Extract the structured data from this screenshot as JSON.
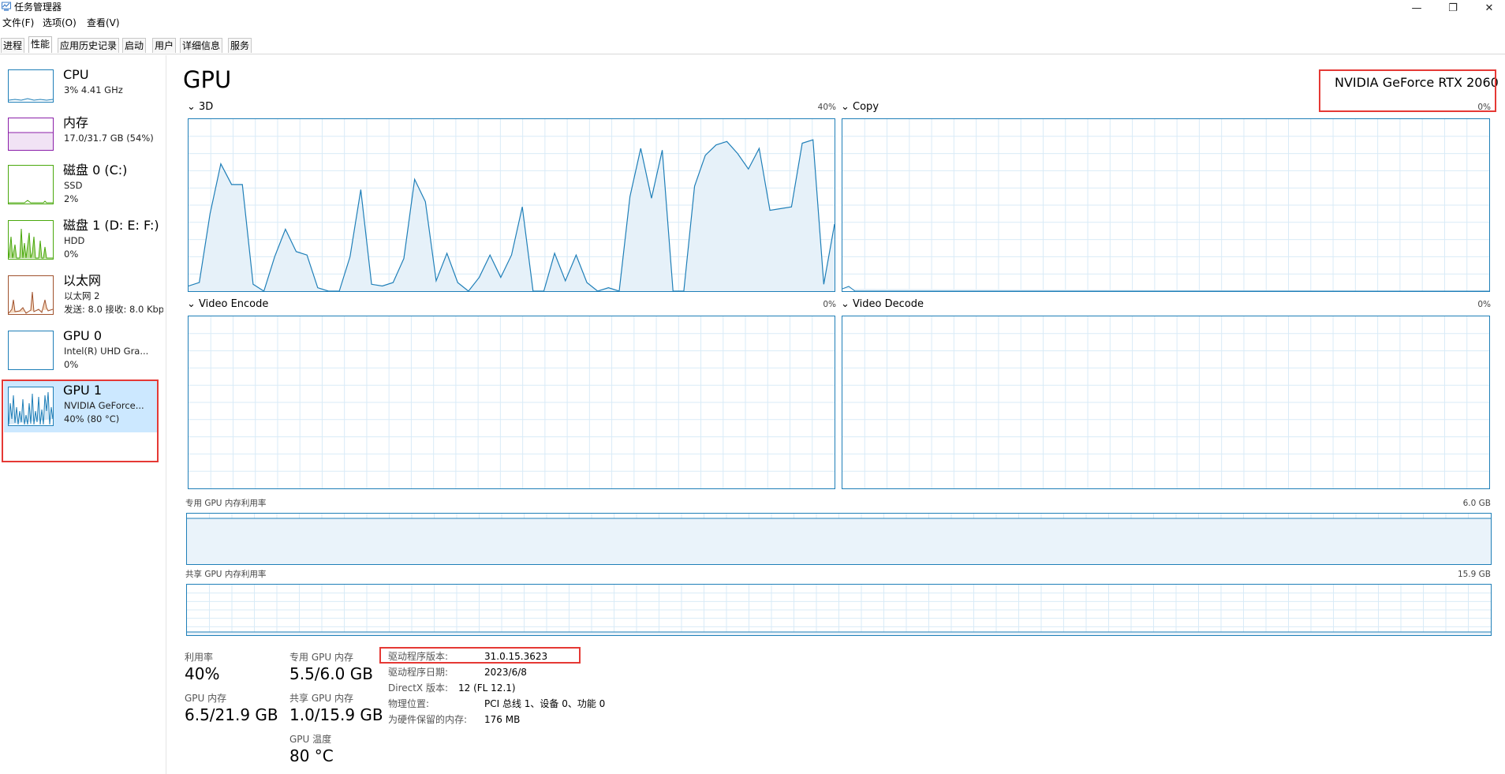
{
  "window": {
    "title": "任务管理器",
    "controls": {
      "minimize": "—",
      "restore": "❐",
      "close": "✕"
    }
  },
  "menu": [
    "文件(F)",
    "选项(O)",
    "查看(V)"
  ],
  "tabs": [
    "进程",
    "性能",
    "应用历史记录",
    "启动",
    "用户",
    "详细信息",
    "服务"
  ],
  "active_tab": "性能",
  "sidebar": {
    "items": [
      {
        "title": "CPU",
        "line1": "3% 4.41 GHz",
        "line2": "",
        "color": "#1f7fb8"
      },
      {
        "title": "内存",
        "line1": "17.0/31.7 GB (54%)",
        "line2": "",
        "color": "#8b1fa9"
      },
      {
        "title": "磁盘 0 (C:)",
        "line1": "SSD",
        "line2": "2%",
        "color": "#4aa80c"
      },
      {
        "title": "磁盘 1 (D: E: F:)",
        "line1": "HDD",
        "line2": "0%",
        "color": "#4aa80c"
      },
      {
        "title": "以太网",
        "line1": "以太网 2",
        "line2": "发送: 8.0  接收: 8.0 Kbps",
        "color": "#a0522d"
      },
      {
        "title": "GPU 0",
        "line1": "Intel(R) UHD Gra...",
        "line2": "0%",
        "color": "#1f7fb8"
      },
      {
        "title": "GPU 1",
        "line1": "NVIDIA GeForce...",
        "line2": "40% (80 °C)",
        "color": "#1f7fb8"
      }
    ],
    "selected": "GPU 1"
  },
  "main": {
    "heading": "GPU",
    "device_name": "NVIDIA GeForce RTX 2060",
    "engines": [
      {
        "name": "3D",
        "pct": "40%"
      },
      {
        "name": "Copy",
        "pct": "0%"
      },
      {
        "name": "Video Encode",
        "pct": "0%"
      },
      {
        "name": "Video Decode",
        "pct": "0%"
      }
    ],
    "dedicated_mem": {
      "label": "专用 GPU 内存利用率",
      "max": "6.0 GB"
    },
    "shared_mem": {
      "label": "共享 GPU 内存利用率",
      "max": "15.9 GB"
    },
    "stats": {
      "utilization_label": "利用率",
      "utilization": "40%",
      "gpu_mem_label": "GPU 内存",
      "gpu_mem": "6.5/21.9 GB",
      "dedicated_label": "专用 GPU 内存",
      "dedicated": "5.5/6.0 GB",
      "shared_label": "共享 GPU 内存",
      "shared": "1.0/15.9 GB",
      "temp_label": "GPU 温度",
      "temp": "80 °C"
    },
    "info": [
      {
        "label": "驱动程序版本:",
        "value": "31.0.15.3623"
      },
      {
        "label": "驱动程序日期:",
        "value": "2023/6/8"
      },
      {
        "label": "DirectX 版本:",
        "value": "12 (FL 12.1)"
      },
      {
        "label": "物理位置:",
        "value": "PCI 总线 1、设备 0、功能 0"
      },
      {
        "label": "为硬件保留的内存:",
        "value": "176 MB"
      }
    ]
  },
  "chart_data": {
    "type": "area",
    "title": "3D",
    "ylim": [
      0,
      100
    ],
    "x": [
      0,
      1,
      2,
      3,
      4,
      5,
      6,
      7,
      8,
      9,
      10,
      11,
      12,
      13,
      14,
      15,
      16,
      17,
      18,
      19,
      20,
      21,
      22,
      23,
      24,
      25,
      26,
      27,
      28,
      29,
      30,
      31,
      32,
      33,
      34,
      35,
      36,
      37,
      38,
      39,
      40,
      41,
      42,
      43,
      44,
      45,
      46,
      47,
      48,
      49,
      50,
      51,
      52,
      53,
      54,
      55,
      56,
      57,
      58,
      59,
      60
    ],
    "series": [
      {
        "values": [
          3,
          5,
          45,
          74,
          62,
          62,
          4,
          0,
          20,
          36,
          23,
          21,
          2,
          0,
          0,
          20,
          59,
          4,
          3,
          5,
          19,
          65,
          52,
          6,
          22,
          5,
          0,
          8,
          21,
          8,
          21,
          49,
          0,
          0,
          22,
          6,
          21,
          5,
          0,
          2,
          0,
          55,
          83,
          54,
          82,
          0,
          0,
          61,
          79,
          85,
          87,
          80,
          71,
          83,
          47,
          48,
          49,
          86,
          88,
          4,
          39
        ]
      }
    ]
  }
}
